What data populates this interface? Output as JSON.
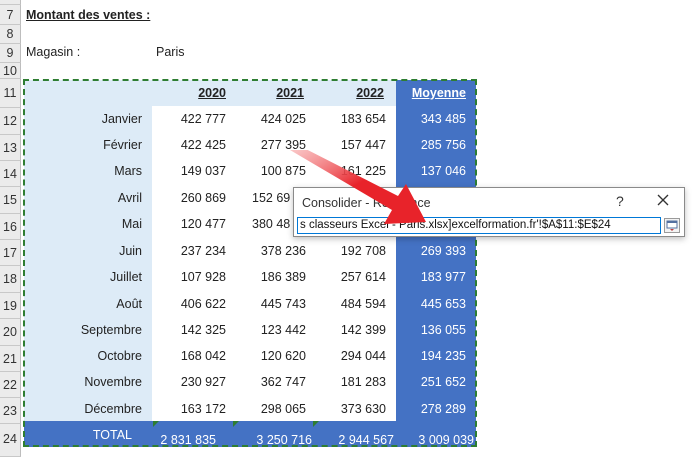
{
  "rows": [
    "7",
    "8",
    "9",
    "10",
    "11",
    "12",
    "13",
    "14",
    "15",
    "16",
    "17",
    "18",
    "19",
    "20",
    "21",
    "22",
    "23",
    "24"
  ],
  "heading": "Montant des ventes :",
  "store_label": "Magasin :",
  "store_value": "Paris",
  "year_headers": [
    "2020",
    "2021",
    "2022"
  ],
  "average_header": "Moyenne",
  "table": [
    {
      "month": "Janvier",
      "v2020": "422 777",
      "v2021": "424 025",
      "v2022": "183 654",
      "avg": "343 485"
    },
    {
      "month": "Février",
      "v2020": "422 425",
      "v2021": "277 395",
      "v2022": "157 447",
      "avg": "285 756"
    },
    {
      "month": "Mars",
      "v2020": "149 037",
      "v2021": "100 875",
      "v2022": "161 225",
      "avg": "137 046"
    },
    {
      "month": "Avril",
      "v2020": "260 869",
      "v2021": "152 69",
      "v2022": "",
      "avg": ""
    },
    {
      "month": "Mai",
      "v2020": "120 477",
      "v2021": "380 48",
      "v2022": "",
      "avg": ""
    },
    {
      "month": "Juin",
      "v2020": "237 234",
      "v2021": "378 236",
      "v2022": "192 708",
      "avg": "269 393"
    },
    {
      "month": "Juillet",
      "v2020": "107 928",
      "v2021": "186 389",
      "v2022": "257 614",
      "avg": "183 977"
    },
    {
      "month": "Août",
      "v2020": "406 622",
      "v2021": "445 743",
      "v2022": "484 594",
      "avg": "445 653"
    },
    {
      "month": "Septembre",
      "v2020": "142 325",
      "v2021": "123 442",
      "v2022": "142 399",
      "avg": "136 055"
    },
    {
      "month": "Octobre",
      "v2020": "168 042",
      "v2021": "120 620",
      "v2022": "294 044",
      "avg": "194 235"
    },
    {
      "month": "Novembre",
      "v2020": "230 927",
      "v2021": "362 747",
      "v2022": "181 283",
      "avg": "251 652"
    },
    {
      "month": "Décembre",
      "v2020": "163 172",
      "v2021": "298 065",
      "v2022": "373 630",
      "avg": "278 289"
    }
  ],
  "total": {
    "label": "TOTAL",
    "v2020": "2 831 835",
    "v2021": "3 250 716",
    "v2022": "2 944 567",
    "avg": "3 009 039"
  },
  "dialog": {
    "title": "Consolider - Référence",
    "help": "?",
    "reference": "s classeurs Excel - Paris.xlsx]excelformation.fr'!$A$11:$E$24",
    "close_icon": "close-icon",
    "collapse_icon": "collapse-dialog-icon"
  },
  "colors": {
    "blue": "#4472c4",
    "light_blue": "#ddebf7",
    "marquee": "#2e7d32",
    "arrow": "#e8232a"
  }
}
